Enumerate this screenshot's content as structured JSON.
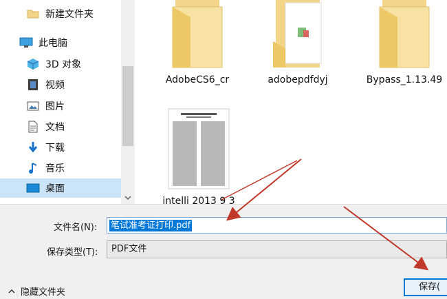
{
  "sidebar": {
    "items": [
      {
        "label": "新建文件夹",
        "icon": "folder-icon"
      },
      {
        "label": "此电脑",
        "icon": "computer-icon"
      },
      {
        "label": "3D 对象",
        "icon": "cube-3d-icon"
      },
      {
        "label": "视频",
        "icon": "video-icon"
      },
      {
        "label": "图片",
        "icon": "picture-icon"
      },
      {
        "label": "文档",
        "icon": "document-icon"
      },
      {
        "label": "下载",
        "icon": "download-icon"
      },
      {
        "label": "音乐",
        "icon": "music-icon"
      },
      {
        "label": "桌面",
        "icon": "desktop-icon",
        "selected": true
      }
    ]
  },
  "files": [
    {
      "label": "AdobeCS6_cr",
      "type": "folder"
    },
    {
      "label": "adobepdfdyj",
      "type": "folder"
    },
    {
      "label": "Bypass_1.13.49",
      "type": "folder"
    },
    {
      "label": "intelli 2013 9 3",
      "type": "pdf"
    }
  ],
  "footer": {
    "filename_label": "文件名(N):",
    "filename_value": "笔试准考证打印.pdf",
    "filetype_label": "保存类型(T):",
    "filetype_value": "PDF文件",
    "hide_folders": "隐藏文件夹",
    "save_button": "保存("
  },
  "colors": {
    "selection": "#0078d7",
    "nav_selected": "#cce4f7",
    "annotation_arrow": "#c0392b",
    "folder": "#f3d58a"
  }
}
